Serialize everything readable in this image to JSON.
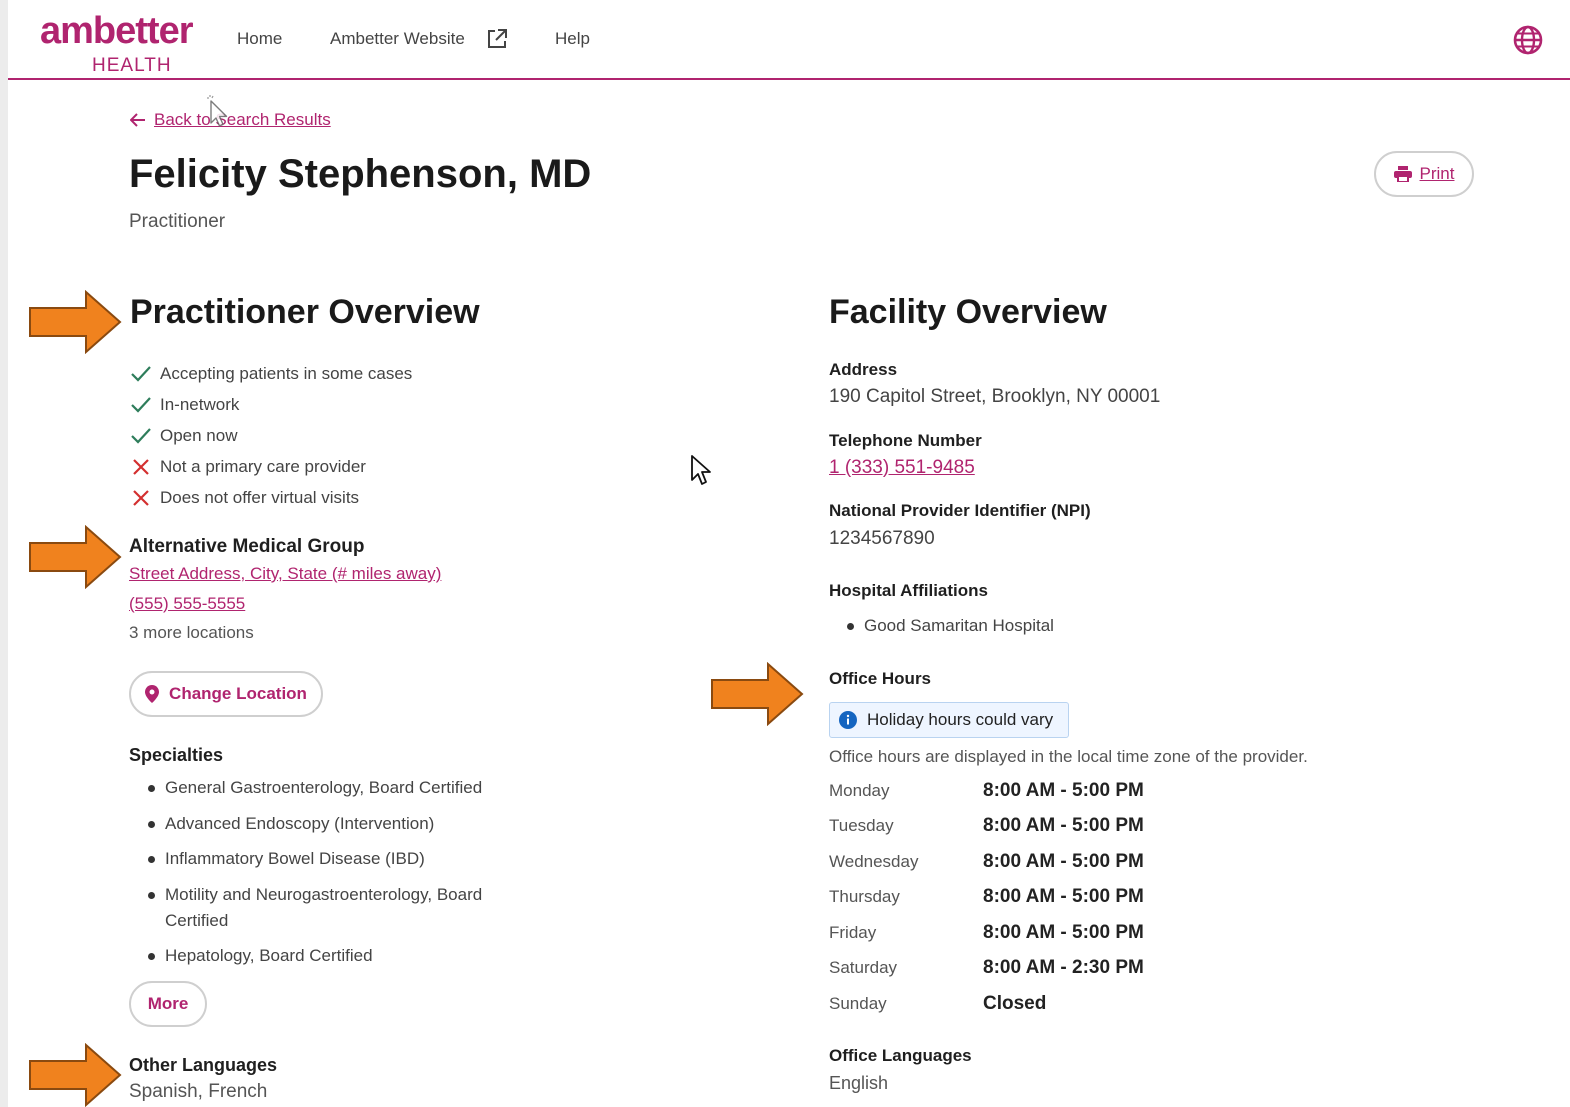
{
  "header": {
    "logo_main": "ambetter",
    "logo_sub": "HEALTH",
    "nav": {
      "home": "Home",
      "website": "Ambetter Website",
      "help": "Help"
    }
  },
  "page": {
    "back_link": "Back to Search Results",
    "title": "Felicity Stephenson, MD",
    "subtitle": "Practitioner",
    "print_label": "Print"
  },
  "practitioner": {
    "heading": "Practitioner Overview",
    "attributes": [
      {
        "text": "Accepting patients in some cases",
        "status": "yes"
      },
      {
        "text": "In-network",
        "status": "yes"
      },
      {
        "text": "Open now",
        "status": "yes"
      },
      {
        "text": "Not a primary care provider",
        "status": "no"
      },
      {
        "text": "Does not offer virtual visits",
        "status": "no"
      }
    ],
    "group_name": "Alternative Medical Group",
    "group_address": "Street Address, City, State (# miles away)",
    "group_phone": "(555) 555-5555",
    "more_locations": "3 more locations",
    "change_location": "Change Location",
    "specialties_heading": "Specialties",
    "specialties": [
      "General Gastroenterology, Board Certified",
      "Advanced Endoscopy (Intervention)",
      "Inflammatory Bowel Disease (IBD)",
      "Motility and Neurogastroenterology, Board Certified",
      "Hepatology, Board Certified"
    ],
    "more_label": "More",
    "languages_heading": "Other Languages",
    "languages": "Spanish, French"
  },
  "facility": {
    "heading": "Facility Overview",
    "address_label": "Address",
    "address": "190 Capitol Street, Brooklyn, NY 00001",
    "phone_label": "Telephone Number",
    "phone": "1 (333) 551-9485",
    "npi_label": "National Provider Identifier (NPI)",
    "npi": "1234567890",
    "hospital_label": "Hospital Affiliations",
    "hospitals": [
      "Good Samaritan Hospital"
    ],
    "hours_label": "Office Hours",
    "holiday_notice": "Holiday hours could vary",
    "hours_note": "Office hours are displayed in the local time zone of the provider.",
    "hours": [
      {
        "day": "Monday",
        "time": "8:00 AM - 5:00 PM"
      },
      {
        "day": "Tuesday",
        "time": "8:00 AM - 5:00 PM"
      },
      {
        "day": "Wednesday",
        "time": "8:00 AM - 5:00 PM"
      },
      {
        "day": "Thursday",
        "time": "8:00 AM - 5:00 PM"
      },
      {
        "day": "Friday",
        "time": "8:00 AM - 5:00 PM"
      },
      {
        "day": "Saturday",
        "time": "8:00 AM - 2:30 PM"
      },
      {
        "day": "Sunday",
        "time": "Closed"
      }
    ],
    "languages_label": "Office Languages",
    "languages": "English"
  },
  "colors": {
    "brand": "#b0246f",
    "check": "#2e7d5b",
    "cross": "#d32f2f",
    "annotation_arrow": "#f0821e",
    "info": "#1565c0"
  },
  "icons": {
    "external": "external-link-icon",
    "globe": "globe-icon",
    "back": "arrow-left-icon",
    "print": "printer-icon",
    "check": "check-icon",
    "cross": "x-icon",
    "pin": "map-pin-icon",
    "info": "info-icon"
  }
}
